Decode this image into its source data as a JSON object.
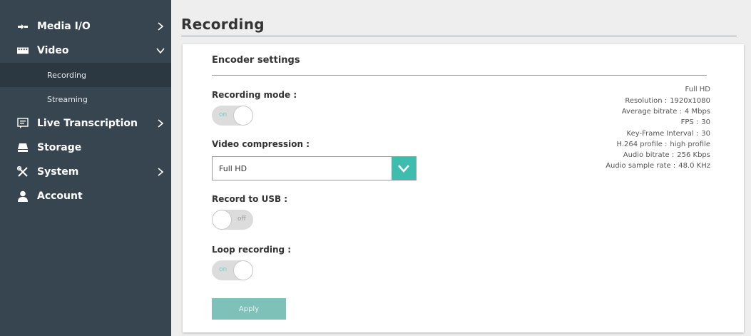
{
  "sidebar": {
    "items": [
      {
        "label": "Media I/O",
        "icon": "media-io-icon",
        "chevron": "right"
      },
      {
        "label": "Video",
        "icon": "video-icon",
        "chevron": "down"
      },
      {
        "label": "Live Transcription",
        "icon": "transcription-icon",
        "chevron": "right"
      },
      {
        "label": "Storage",
        "icon": "storage-icon",
        "chevron": "none"
      },
      {
        "label": "System",
        "icon": "system-tools-icon",
        "chevron": "right"
      },
      {
        "label": "Account",
        "icon": "account-icon",
        "chevron": "none"
      }
    ],
    "video_sub": [
      {
        "label": "Recording",
        "active": true
      },
      {
        "label": "Streaming",
        "active": false
      }
    ]
  },
  "main": {
    "title": "Recording",
    "panel_title": "Encoder settings",
    "recording_mode": {
      "label": "Recording mode :",
      "state": "on"
    },
    "video_compression": {
      "label": "Video compression :",
      "value": "Full HD"
    },
    "record_to_usb": {
      "label": "Record to USB :",
      "state": "off"
    },
    "loop_recording": {
      "label": "Loop recording :",
      "state": "on"
    },
    "apply_label": "Apply",
    "info": {
      "preset": "Full HD",
      "rows": [
        {
          "key": "Resolution :",
          "value": "1920x1080"
        },
        {
          "key": "Average bitrate :",
          "value": "4 Mbps"
        },
        {
          "key": "FPS :",
          "value": "30"
        },
        {
          "key": "Key-Frame Interval :",
          "value": "30"
        },
        {
          "key": "H.264 profile :",
          "value": "high profile"
        },
        {
          "key": "Audio bitrate :",
          "value": "256 Kbps"
        },
        {
          "key": "Audio sample rate :",
          "value": "48.0 KHz"
        }
      ]
    }
  },
  "colors": {
    "sidebar_bg": "#36454f",
    "accent": "#3cbdb0",
    "apply_bg": "#7ec1b8",
    "toggle_on_text": "#6fd2c7"
  }
}
